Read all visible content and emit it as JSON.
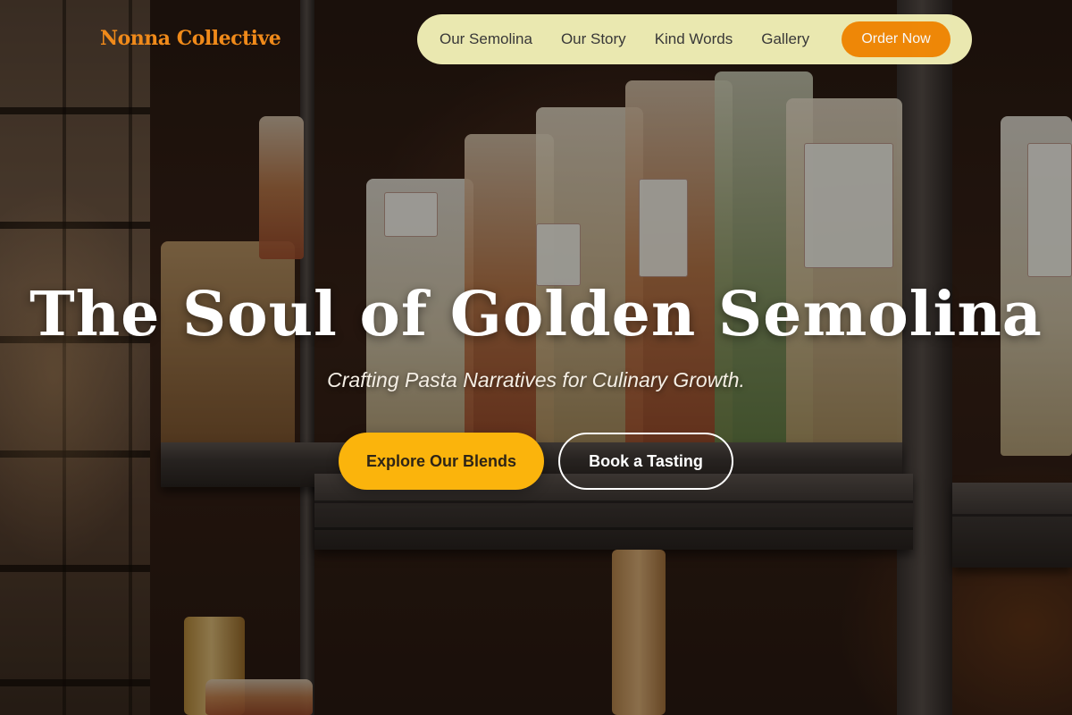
{
  "brand": {
    "name": "Nonna Collective",
    "accent": "#f08a1a"
  },
  "nav": {
    "items": [
      {
        "label": "Our Semolina"
      },
      {
        "label": "Our Story"
      },
      {
        "label": "Kind Words"
      },
      {
        "label": "Gallery"
      }
    ],
    "cta_label": "Order Now",
    "background": "#f1efb6",
    "cta_color": "#f58b07"
  },
  "hero": {
    "title": "The Soul of Golden Semolina",
    "subtitle": "Crafting Pasta Narratives for Culinary Growth.",
    "primary_button": "Explore Our Blends",
    "secondary_button": "Book a Tasting",
    "primary_color": "#fbb40c"
  }
}
